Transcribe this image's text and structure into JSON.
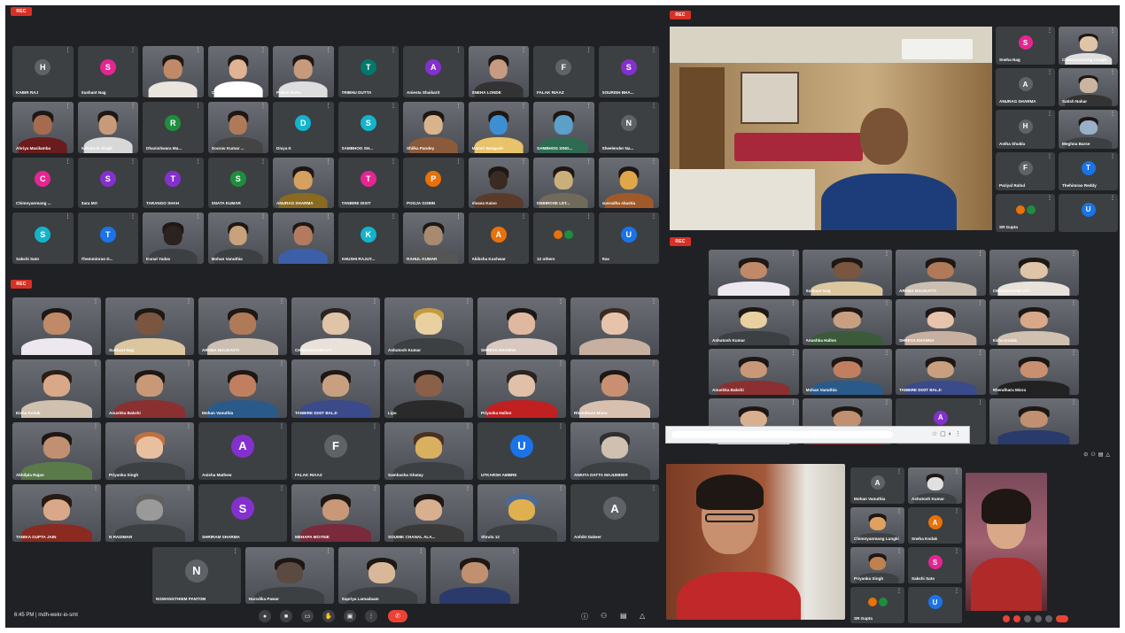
{
  "rec_badge": "REC",
  "grid1": [
    {
      "name": "KABIR RAJ",
      "initial": "H",
      "color": "#5f6368"
    },
    {
      "name": "Sushant Nag",
      "initial": "S",
      "color": "#e52592"
    },
    {
      "name": "",
      "initial": "",
      "video": true,
      "skin": "#c08a68",
      "shirt": "#e9e4dc"
    },
    {
      "name": "Chimbi",
      "initial": "",
      "video": true,
      "skin": "#e0b394",
      "shirt": "#ffffff"
    },
    {
      "name": "Pallavi Dutta",
      "initial": "",
      "video": true,
      "skin": "#c69a7c",
      "shirt": "#ddd"
    },
    {
      "name": "TRIBHU DUTTA",
      "initial": "T",
      "color": "#00796b"
    },
    {
      "name": "Aniesta Shaikarit",
      "initial": "A",
      "color": "#8430ce"
    },
    {
      "name": "SNEHA LONDE",
      "initial": "",
      "video": true,
      "skin": "#c79a82",
      "shirt": "#333"
    },
    {
      "name": "FALAK RIAAZ",
      "initial": "F",
      "color": "#5f6368"
    },
    {
      "name": "SOURISH BHA...",
      "initial": "S",
      "color": "#8430ce"
    },
    {
      "name": "Ahriya Masilamba",
      "initial": "",
      "video": true,
      "skin": "#a66b4f",
      "shirt": "#6a1b1b"
    },
    {
      "name": "Ashutosh Singh",
      "initial": "",
      "video": true,
      "skin": "#c99a7a",
      "shirt": "#d8d8d8"
    },
    {
      "name": "Dhanishwara Ma...",
      "initial": "R",
      "color": "#1e8e3e"
    },
    {
      "name": "Gourav Kumar ...",
      "initial": "",
      "video": true,
      "skin": "#b07a59",
      "shirt": "#444"
    },
    {
      "name": "Divya K",
      "initial": "D",
      "color": "#12b5cb"
    },
    {
      "name": "SAMBHOG SH...",
      "initial": "S",
      "color": "#12b5cb"
    },
    {
      "name": "Shilka Pandey",
      "initial": "",
      "video": true,
      "skin": "#d9b38c",
      "shirt": "#8a5a3a"
    },
    {
      "name": "Manvir Bangash",
      "initial": "",
      "video": true,
      "skin": "#3d8fd1",
      "shirt": "#e8c36a"
    },
    {
      "name": "SAMBHOG SING...",
      "initial": "",
      "video": true,
      "skin": "#5aa0c8",
      "shirt": "#2e6b52"
    },
    {
      "name": "Sheelender Na...",
      "initial": "N",
      "color": "#5f6368"
    },
    {
      "name": "Chimnyanmang ...",
      "initial": "C",
      "color": "#e52592"
    },
    {
      "name": "Sara Mrt",
      "initial": "S",
      "color": "#8430ce"
    },
    {
      "name": "TARANGO SHAH",
      "initial": "T",
      "color": "#8430ce"
    },
    {
      "name": "SNATA KUMAR",
      "initial": "S",
      "color": "#1e8e3e"
    },
    {
      "name": "ANURAG SHARMA",
      "initial": "",
      "video": true,
      "skin": "#d6a060",
      "shirt": "#8a6a20"
    },
    {
      "name": "TANBIRE DIXIT",
      "initial": "T",
      "color": "#e52592"
    },
    {
      "name": "POOJA GOBIN",
      "initial": "P",
      "color": "#e8710a"
    },
    {
      "name": "Vivasa Kaiso",
      "initial": "",
      "video": true,
      "skin": "#3a2a22",
      "shirt": "#5b3a2a"
    },
    {
      "name": "DEBIROSE LET...",
      "initial": "",
      "video": true,
      "skin": "#c9b07a",
      "shirt": "#6f6a5a"
    },
    {
      "name": "suvradha shastia",
      "initial": "",
      "video": true,
      "skin": "#e0a64a",
      "shirt": "#a05a2a"
    },
    {
      "name": "Sakshi Sato",
      "initial": "S",
      "color": "#12b5cb"
    },
    {
      "name": "Themminrao D...",
      "initial": "T",
      "color": "#1a73e8"
    },
    {
      "name": "Kunal Yadav",
      "initial": "",
      "video": true,
      "skin": "#2a2320",
      "shirt": "#3c4043"
    },
    {
      "name": "Mohan Vanuthia",
      "initial": "",
      "video": true,
      "skin": "#c7a27a",
      "shirt": "#3c4043"
    },
    {
      "name": "",
      "initial": "",
      "video": true,
      "skin": "#b37a5f",
      "shirt": "#3b5fa8",
      "active": true
    },
    {
      "name": "KHUSHI RAJUT...",
      "initial": "K",
      "color": "#12b5cb"
    },
    {
      "name": "RAHUL KUMAR",
      "initial": "",
      "video": true,
      "skin": "#a88a70",
      "shirt": "#555"
    },
    {
      "name": "Akiksha Kushwar",
      "initial": "A",
      "color": "#e8710a"
    },
    {
      "name": "12 others",
      "initial": "",
      "color": "#3c4043",
      "others": true
    },
    {
      "name": "Rav",
      "initial": "U",
      "color": "#1a73e8"
    }
  ],
  "grid2": [
    {
      "name": "",
      "video": true,
      "skin": "#c08a68",
      "shirt": "#ede8f0",
      "hair": "#1e1714"
    },
    {
      "name": "Sushant Nag",
      "video": true,
      "skin": "#7a5540",
      "shirt": "#dcc6a0",
      "hair": "#1e1714"
    },
    {
      "name": "ARABA NALIKAYTI",
      "video": true,
      "skin": "#b07a59",
      "shirt": "#cbbfb2",
      "hair": "#1e1714"
    },
    {
      "name": "CHINGAKHAM LKY",
      "video": true,
      "skin": "#e0c4a8",
      "shirt": "#e8e2da",
      "hair": "#2a2320"
    },
    {
      "name": "Ashutosh Kumar",
      "initial": "",
      "video": true,
      "skin": "#e8d0a0",
      "shirt": "#3c4043",
      "hair": "#c49a40"
    },
    {
      "name": "SHREYA KHANNA",
      "video": true,
      "skin": "#e0b8a0",
      "shirt": "#d8c8c0",
      "hair": "#1e1714"
    },
    {
      "name": "",
      "video": true,
      "skin": "#e6c3aa",
      "shirt": "#c8b0a0",
      "hair": "#3a2a22"
    },
    {
      "name": "Eisha Kodak",
      "video": true,
      "skin": "#d8a888",
      "shirt": "#d0c0b0",
      "hair": "#2a1f18"
    },
    {
      "name": "Anushka Bakshi",
      "video": true,
      "skin": "#c89878",
      "shirt": "#8a3030",
      "hair": "#1e1714"
    },
    {
      "name": "Mohan Vanuthia",
      "video": true,
      "skin": "#c08060",
      "shirt": "#2a5a8a",
      "hair": "#1e1714"
    },
    {
      "name": "TANBIRE DIXIT BALJI",
      "video": true,
      "skin": "#c8a080",
      "shirt": "#3a4a8a",
      "hair": "#1e1714"
    },
    {
      "name": "Lipo",
      "video": true,
      "skin": "#8a6048",
      "shirt": "#2a2a2a",
      "hair": "#1e1714"
    },
    {
      "name": "Priyanka Hallon",
      "video": true,
      "skin": "#e0c0a8",
      "shirt": "#c02020",
      "hair": "#2a2320"
    },
    {
      "name": "Rhendharu Misra",
      "video": true,
      "skin": "#c89070",
      "shirt": "#d8c0b0",
      "hair": "#1e1714"
    },
    {
      "name": "Akhilpla Rajan",
      "video": true,
      "skin": "#c09070",
      "shirt": "#5a7a4a",
      "hair": "#1e1714"
    },
    {
      "name": "Priyanka Singh",
      "initial": "",
      "video": true,
      "skin": "#e8c0a0",
      "shirt": "#3c4043",
      "hair": "#c07040"
    },
    {
      "name": "Anisha Mathew",
      "initial": "A",
      "color": "#8430ce"
    },
    {
      "name": "FALAK RIAAZ",
      "initial": "F",
      "color": "#5f6368"
    },
    {
      "name": "Sambasha Ghatay",
      "initial": "",
      "video": true,
      "skin": "#d8b060",
      "shirt": "#3c4043",
      "hair": "#4a3020"
    },
    {
      "name": "UTKARSH AMBRE",
      "initial": "U",
      "color": "#1a73e8"
    },
    {
      "name": "ANKITA DATTA MAJUMDER",
      "initial": "",
      "video": true,
      "skin": "#d0c0b0",
      "shirt": "#3c4043",
      "hair": "#303030"
    },
    {
      "name": "TANIKA GUPTA JAIN",
      "video": true,
      "skin": "#d8a888",
      "shirt": "#8a2a20",
      "hair": "#2a1a14"
    },
    {
      "name": "N RADIMAR",
      "initial": "",
      "video": true,
      "skin": "#9a9a9a",
      "shirt": "#3c4043",
      "hair": "#606060"
    },
    {
      "name": "SHRIRAM SHARMA",
      "initial": "S",
      "color": "#8430ce"
    },
    {
      "name": "MEHAPA MOYNIE",
      "video": true,
      "skin": "#c89878",
      "shirt": "#7a2a3a",
      "hair": "#1e1714"
    },
    {
      "name": "SOUMIK CHANAL ALA...",
      "video": true,
      "skin": "#d8b090",
      "shirt": "#3a3a3a",
      "hair": "#1e1714"
    },
    {
      "name": "Shrulu 12",
      "initial": "",
      "video": true,
      "skin": "#e0b050",
      "shirt": "#3c4043",
      "hair": "#4a6a9a"
    },
    {
      "name": "Anhikt Dakeer",
      "initial": "A",
      "color": "#5f6368"
    }
  ],
  "grid2_lastrow": [
    {
      "name": "NGWANGTHIEM PANTOM",
      "initial": "N",
      "color": "#5f6368"
    },
    {
      "name": "Harsdika Pawar",
      "video": true,
      "skin": "#5a4a40",
      "shirt": "#3c4043",
      "hair": "#1e1714"
    },
    {
      "name": "Supriya Lamadaam",
      "video": true,
      "skin": "#d8b898",
      "shirt": "#3c4043",
      "hair": "#1e1714"
    },
    {
      "name": "",
      "video": true,
      "skin": "#c09070",
      "shirt": "#2a3a6a",
      "hair": "#1e1714",
      "active": true
    }
  ],
  "grid3": [
    {
      "name": "Sneha Nag",
      "initial": "S",
      "color": "#e52592"
    },
    {
      "name": "Chimnyanmang Lungki",
      "video": true,
      "skin": "#e0c4a8",
      "shirt": "#ddd"
    },
    {
      "name": "ANURAG SHARMA",
      "initial": "A",
      "color": "#5f6368"
    },
    {
      "name": "Satish Nahar",
      "video": true,
      "skin": "#c9b5a0",
      "shirt": "#333"
    },
    {
      "name": "Astha Shukla",
      "initial": "H",
      "color": "#5f6368"
    },
    {
      "name": "Meghna Barse",
      "video": true,
      "skin": "#9ab0c8",
      "shirt": "#3c4043"
    },
    {
      "name": "Pariyal Rahul",
      "initial": "F",
      "color": "#5f6368"
    },
    {
      "name": "Thehimrao Reddy",
      "initial": "T",
      "color": "#1a73e8"
    },
    {
      "name": "SR Gupta",
      "initial": "",
      "color": "#12b5cb",
      "pair": true
    },
    {
      "name": "",
      "initial": "U",
      "color": "#1a73e8"
    }
  ],
  "grid4": [
    {
      "name": "",
      "video": true,
      "skin": "#c08a68",
      "shirt": "#ede8f0"
    },
    {
      "name": "Sushant Nag",
      "video": true,
      "skin": "#7a5540",
      "shirt": "#dcc6a0",
      "active": true
    },
    {
      "name": "ARABA NALIKAYTI",
      "video": true,
      "skin": "#b07a59",
      "shirt": "#cbbfb2"
    },
    {
      "name": "CHINGAKHAM LKY",
      "video": true,
      "skin": "#e0c4a8",
      "shirt": "#e8e2da"
    },
    {
      "name": "Ashutosh Kumar",
      "video": true,
      "skin": "#e8d0a0",
      "shirt": "#3c4043"
    },
    {
      "name": "Anushka Hallon",
      "video": true,
      "skin": "#c8a080",
      "shirt": "#3a5a3a"
    },
    {
      "name": "SHREYA KHANNA",
      "video": true,
      "skin": "#e6c3aa",
      "shirt": "#c8b0a0"
    },
    {
      "name": "Eisha Kodak",
      "video": true,
      "skin": "#d8a888",
      "shirt": "#d0c0b0"
    },
    {
      "name": "Anushka Bakshi",
      "video": true,
      "skin": "#c89878",
      "shirt": "#8a3030"
    },
    {
      "name": "Mohan Vanuthia",
      "video": true,
      "skin": "#c08060",
      "shirt": "#2a5a8a"
    },
    {
      "name": "TANBIRE DIXIT BALJI",
      "video": true,
      "skin": "#c8a080",
      "shirt": "#3a4a8a"
    },
    {
      "name": "Rhendharu Misra",
      "video": true,
      "skin": "#c89070",
      "shirt": "#222"
    },
    {
      "name": "",
      "video": true,
      "skin": "#d8b090",
      "shirt": "#ddd"
    },
    {
      "name": "",
      "video": true,
      "skin": "#c09070",
      "shirt": "#a02a2a"
    },
    {
      "name": "",
      "initial": "A",
      "color": "#8430ce"
    },
    {
      "name": "",
      "video": true,
      "skin": "#c09070",
      "shirt": "#2a3a6a"
    }
  ],
  "grid5": [
    {
      "name": "Mohan Vanuthia",
      "initial": "A",
      "color": "#5f6368"
    },
    {
      "name": "Ashutosh Kumar",
      "video": true,
      "skin": "#e0e0e0",
      "shirt": "#3c4043"
    },
    {
      "name": "Chimnyanmang Lungki",
      "video": true,
      "skin": "#e0a060",
      "shirt": "#3c4043"
    },
    {
      "name": "Sneha Kodak",
      "initial": "A",
      "color": "#e8710a"
    },
    {
      "name": "Priyanka Singh",
      "video": true,
      "skin": "#c08050",
      "shirt": "#3c4043"
    },
    {
      "name": "Sakshi Sato",
      "initial": "S",
      "color": "#e52592"
    },
    {
      "name": "SR Gupta",
      "initial": "",
      "color": "#3c4043",
      "pair": true
    },
    {
      "name": "",
      "initial": "U",
      "color": "#1a73e8"
    }
  ],
  "bottombar": {
    "clock": "6:45 PM",
    "meeting_code": "| mdh-wekr-io-smt"
  }
}
